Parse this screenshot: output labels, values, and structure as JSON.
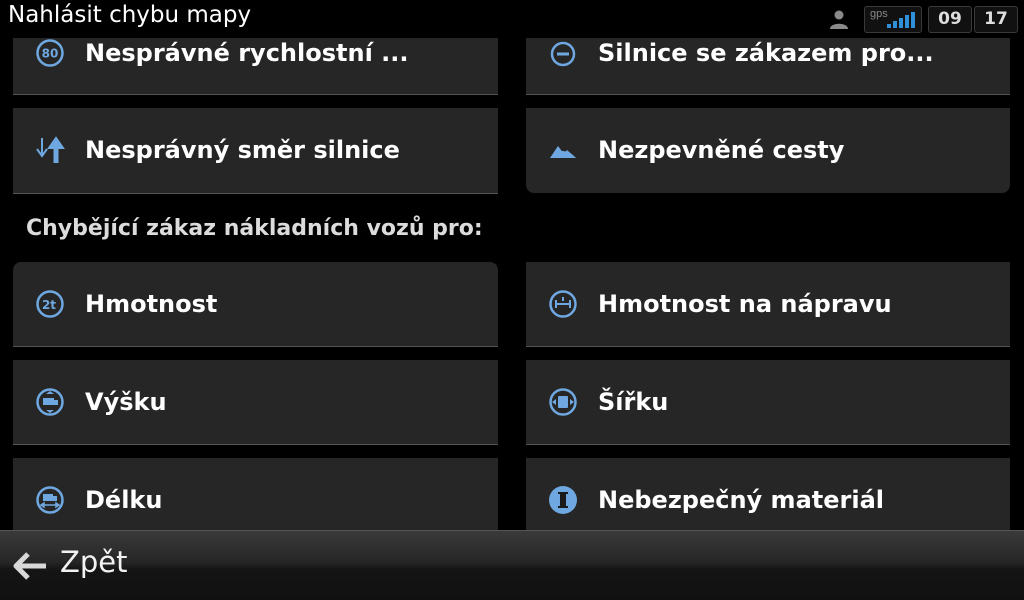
{
  "header": {
    "title": "Nahlásit chybu mapy",
    "gps_label": "gps",
    "clock_hours": "09",
    "clock_minutes": "17"
  },
  "top_items": [
    {
      "label": "Nesprávné rychlostní ...",
      "icon": "speed-limit-80-icon",
      "icon_text": "80"
    },
    {
      "label": "Silnice se zákazem pro...",
      "icon": "no-entry-icon"
    },
    {
      "label": "Nesprávný směr silnice",
      "icon": "road-direction-icon"
    },
    {
      "label": "Nezpevněné cesty",
      "icon": "unpaved-road-icon"
    }
  ],
  "section": {
    "title": "Chybějící zákaz nákladních vozů pro:"
  },
  "truck_items": [
    {
      "label": "Hmotnost",
      "icon": "weight-limit-icon",
      "icon_text": "2t"
    },
    {
      "label": "Hmotnost na nápravu",
      "icon": "axle-weight-icon"
    },
    {
      "label": "Výšku",
      "icon": "height-limit-icon"
    },
    {
      "label": "Šířku",
      "icon": "width-limit-icon"
    },
    {
      "label": "Délku",
      "icon": "length-limit-icon"
    },
    {
      "label": "Nebezpečný materiál",
      "icon": "hazardous-material-icon"
    }
  ],
  "footer": {
    "back_label": "Zpět"
  },
  "colors": {
    "icon_blue": "#6fa8e0",
    "tile_bg": "#262626",
    "gps_bar_blue": "#2f8fd8"
  }
}
